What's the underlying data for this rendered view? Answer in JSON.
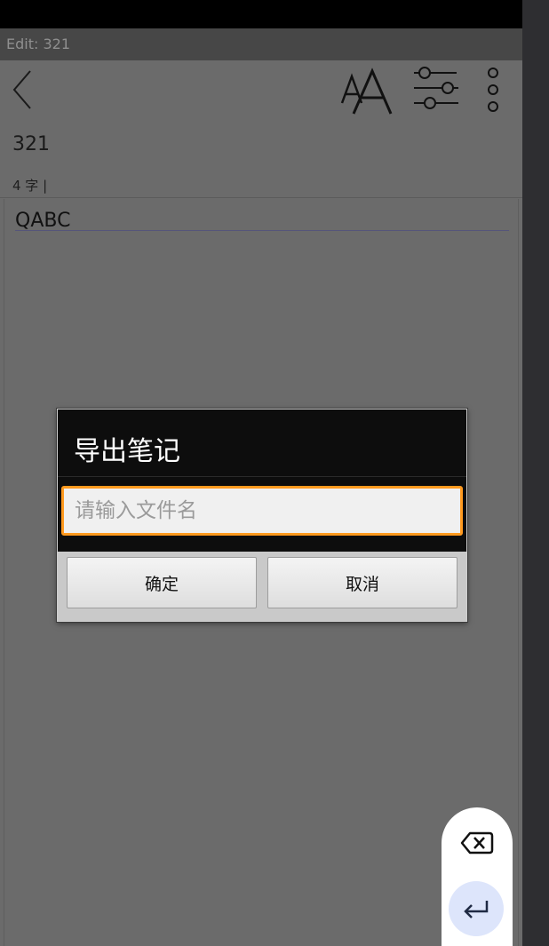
{
  "window": {
    "title": "Edit: 321"
  },
  "toolbar": {
    "back_icon": "chevron-left-icon",
    "font_icon": "font-size-icon",
    "settings_icon": "sliders-icon",
    "more_icon": "more-vertical-icon"
  },
  "note": {
    "title": "321",
    "word_count": "4 字 |",
    "content": "QABC"
  },
  "dialog": {
    "title": "导出笔记",
    "input_placeholder": "请输入文件名",
    "input_value": "",
    "confirm_label": "确定",
    "cancel_label": "取消"
  },
  "keyboard_actions": {
    "delete_icon": "backspace-icon",
    "enter_icon": "enter-arrow-icon"
  },
  "colors": {
    "input_focus_border": "#ff9a1f",
    "dialog_header": "#0d0d0d",
    "enter_button_bg": "#dde5fb"
  }
}
